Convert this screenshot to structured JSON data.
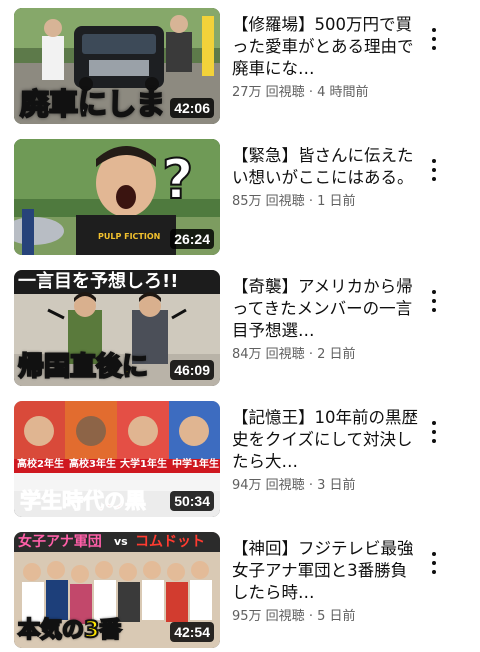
{
  "videos": [
    {
      "title": "【修羅場】500万円で買った愛車がとある理由で廃車にな…",
      "views": "27万 回視聴",
      "age": "4 時間前",
      "duration": "42:06",
      "overlay": {
        "main": "廃車にしま"
      },
      "menu_icon": "more-vert-icon"
    },
    {
      "title": "【緊急】皆さんに伝えたい想いがここにはある。",
      "views": "85万 回視聴",
      "age": "1 日前",
      "duration": "26:24",
      "overlay": {
        "main": "?",
        "shirt": "PULP FICTION"
      },
      "menu_icon": "more-vert-icon"
    },
    {
      "title": "【奇襲】アメリカから帰ってきたメンバーの一言目予想選…",
      "views": "84万 回視聴",
      "age": "2 日前",
      "duration": "46:09",
      "overlay": {
        "top": "一言目を予想しろ!!",
        "main": "帰国直後に"
      },
      "menu_icon": "more-vert-icon"
    },
    {
      "title": "【記憶王】10年前の黒歴史をクイズにして対決したら大…",
      "views": "94万 回視聴",
      "age": "3 日前",
      "duration": "50:34",
      "overlay": {
        "labels": [
          "高校2年生",
          "高校3年生",
          "大学1年生",
          "中学1年生"
        ],
        "main": "学生時代の黒"
      },
      "menu_icon": "more-vert-icon"
    },
    {
      "title": "【神回】フジテレビ最強女子アナ軍団と3番勝負したら時…",
      "views": "95万 回視聴",
      "age": "5 日前",
      "duration": "42:54",
      "overlay": {
        "top_left": "女子アナ軍団",
        "vs": "vs",
        "top_right": "コムドット",
        "main": "本気の3番"
      },
      "menu_icon": "more-vert-icon"
    }
  ],
  "colors": {
    "title_text": "#0f0f0f",
    "meta_text": "#606060",
    "duration_bg": "#000000",
    "overlay_red": "#e8191f",
    "overlay_yellow": "#ffe600"
  }
}
